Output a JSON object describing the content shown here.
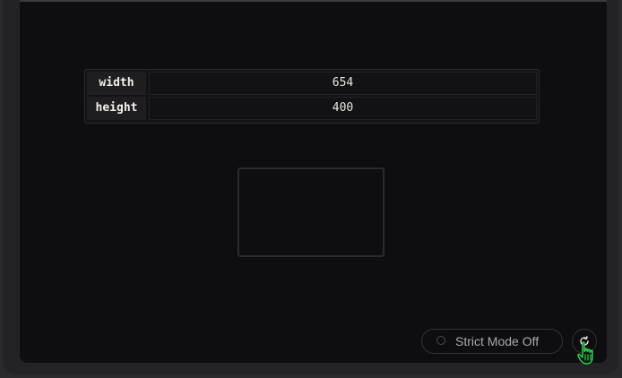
{
  "properties": [
    {
      "key": "width",
      "value": "654"
    },
    {
      "key": "height",
      "value": "400"
    }
  ],
  "controls": {
    "strict_mode_label": "Strict Mode Off",
    "refresh_icon": "refresh-icon",
    "cursor_icon": "hand-pointer-cursor-icon"
  },
  "colors": {
    "background": "#0e0e10",
    "cursor_green": "#39d353"
  }
}
